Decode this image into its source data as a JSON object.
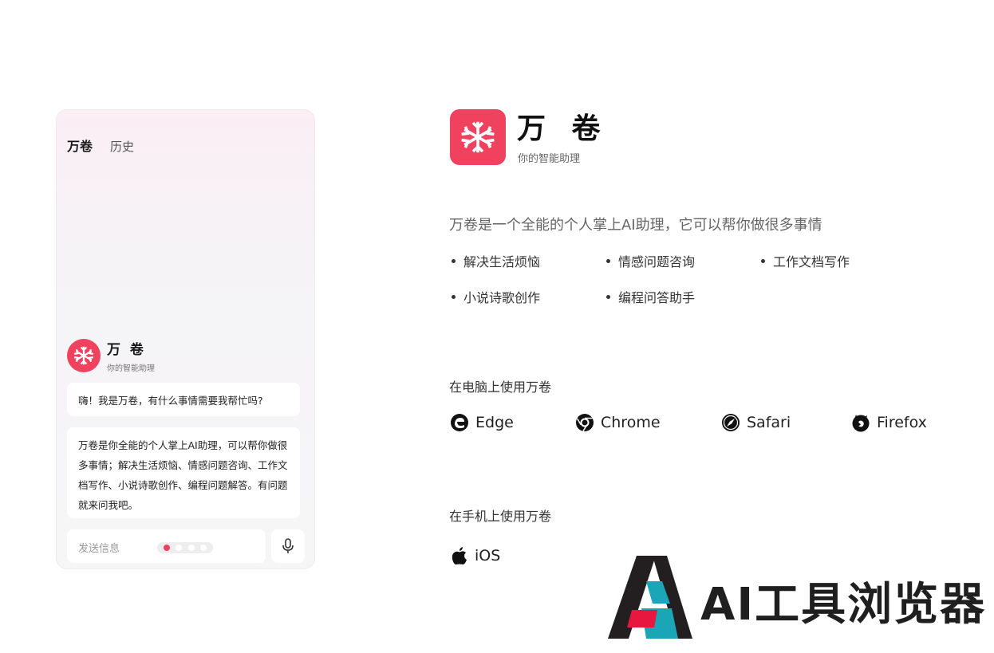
{
  "colors": {
    "accent": "#f0415f",
    "text": "#1a1a1a",
    "muted": "#666666"
  },
  "phone": {
    "tabs": [
      "万卷",
      "历史"
    ],
    "brand_title": "万 卷",
    "brand_sub": "你的智能助理",
    "greeting": "嗨！我是万卷，有什么事情需要我帮忙吗?",
    "intro_message": "万卷是你全能的个人掌上AI助理，可以帮你做很多事情；解决生活烦恼、情感问题咨询、工作文档写作、小说诗歌创作、编程问题解答。有问题就来问我吧。",
    "input_placeholder": "发送信息",
    "pager": {
      "count": 4,
      "active": 1
    },
    "mic_icon": "microphone-icon"
  },
  "app": {
    "title": "万 卷",
    "subtitle": "你的智能助理",
    "intro": "万卷是一个全能的个人掌上AI助理，它可以帮你做很多事情",
    "features": [
      "解决生活烦恼",
      "情感问题咨询",
      "工作文档写作",
      "小说诗歌创作",
      "编程问答助手"
    ]
  },
  "desktop": {
    "title": "在电脑上使用万卷",
    "browsers": [
      {
        "name": "Edge",
        "icon": "edge-icon"
      },
      {
        "name": "Chrome",
        "icon": "chrome-icon"
      },
      {
        "name": "Safari",
        "icon": "safari-icon"
      },
      {
        "name": "Firefox",
        "icon": "firefox-icon"
      }
    ]
  },
  "mobile": {
    "title": "在手机上使用万卷",
    "platforms": [
      {
        "name": "iOS",
        "icon": "apple-icon"
      }
    ]
  },
  "watermark": {
    "text": "AI工具浏览器"
  }
}
